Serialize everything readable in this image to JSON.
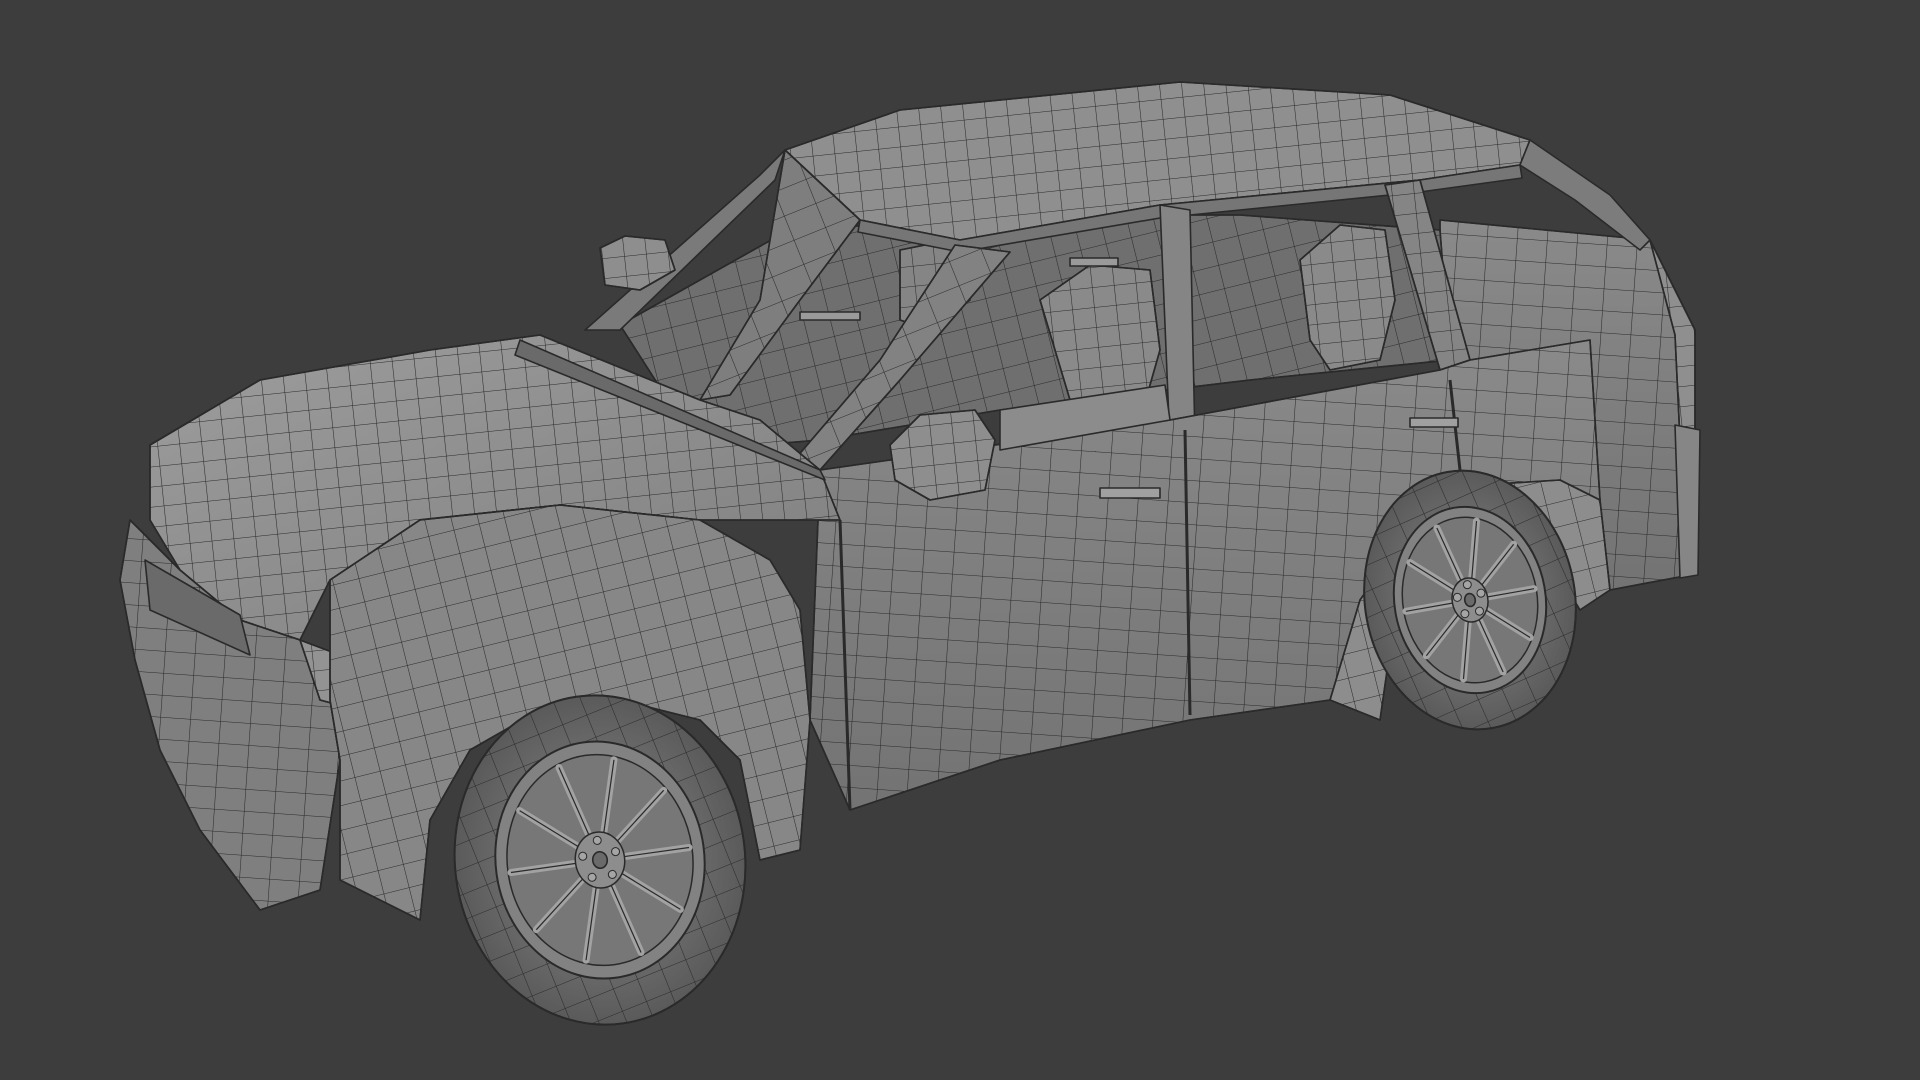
{
  "viewport": {
    "background": "#3d3d3d",
    "mesh_fill": "#7b7b7b",
    "mesh_fill_light": "#9a9a9a",
    "mesh_fill_dark": "#5e5e5e",
    "wire_color": "#2a2a2a",
    "interior_color": "#6f6f6f"
  },
  "model": {
    "subject": "suv-wireframe-mesh",
    "wheels": 2,
    "rim_spokes": 10,
    "lug_nuts": 5
  }
}
